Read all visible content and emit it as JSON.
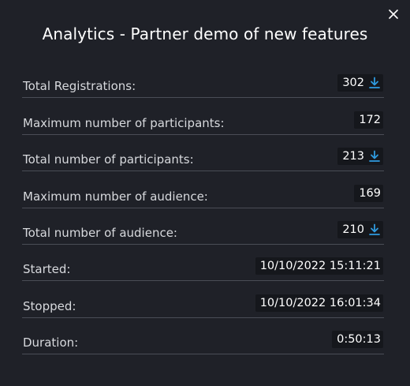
{
  "dialog": {
    "title": "Analytics - Partner demo of new features",
    "close_icon": "close-icon",
    "accent_color": "#2f9be0"
  },
  "rows": [
    {
      "label": "Total Registrations:",
      "value": "302",
      "download": true
    },
    {
      "label": "Maximum number of participants:",
      "value": "172",
      "download": false
    },
    {
      "label": "Total number of participants:",
      "value": "213",
      "download": true
    },
    {
      "label": "Maximum number of audience:",
      "value": "169",
      "download": false
    },
    {
      "label": "Total number of audience:",
      "value": "210",
      "download": true
    },
    {
      "label": "Started:",
      "value": "10/10/2022 15:11:21",
      "download": false
    },
    {
      "label": "Stopped:",
      "value": "10/10/2022 16:01:34",
      "download": false
    },
    {
      "label": "Duration:",
      "value": "0:50:13",
      "download": false
    }
  ]
}
